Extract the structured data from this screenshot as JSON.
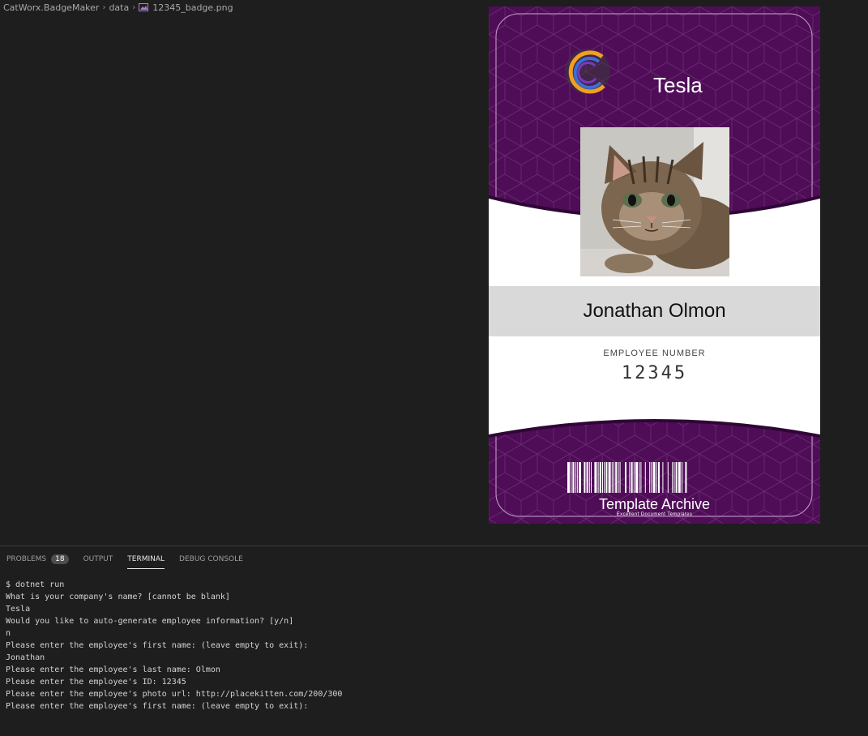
{
  "breadcrumb": {
    "project": "CatWorx.BadgeMaker",
    "folder": "data",
    "file": "12345_badge.png"
  },
  "badge": {
    "company": "Tesla",
    "employee_name": "Jonathan Olmon",
    "employee_number_label": "EMPLOYEE NUMBER",
    "employee_number": "12345",
    "template_title": "Template Archive",
    "template_subtitle": "Excellent Document Templates",
    "colors": {
      "background": "#4f0d57",
      "band": "#d9d9d9",
      "logo_orange": "#f0a020",
      "logo_blue": "#3c6fd6"
    }
  },
  "panel": {
    "tabs": [
      {
        "label": "PROBLEMS",
        "count": "18"
      },
      {
        "label": "OUTPUT"
      },
      {
        "label": "TERMINAL",
        "active": true
      },
      {
        "label": "DEBUG CONSOLE"
      }
    ],
    "terminal_lines": [
      "$ dotnet run",
      "What is your company's name? [cannot be blank]",
      "Tesla",
      "Would you like to auto-generate employee information? [y/n]",
      "n",
      "Please enter the employee's first name: (leave empty to exit):",
      "Jonathan",
      "Please enter the employee's last name: Olmon",
      "Please enter the employee's ID: 12345",
      "Please enter the employee's photo url: http://placekitten.com/200/300",
      "Please enter the employee's first name: (leave empty to exit):"
    ]
  }
}
